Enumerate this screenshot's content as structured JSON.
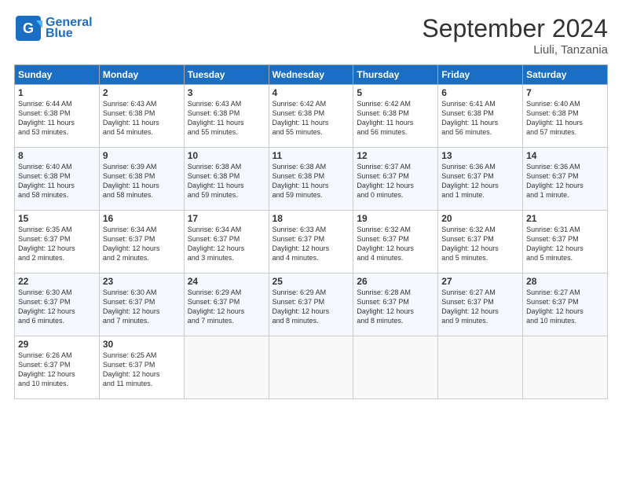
{
  "header": {
    "logo_line1": "General",
    "logo_line2": "Blue",
    "month_title": "September 2024",
    "location": "Liuli, Tanzania"
  },
  "days_of_week": [
    "Sunday",
    "Monday",
    "Tuesday",
    "Wednesday",
    "Thursday",
    "Friday",
    "Saturday"
  ],
  "weeks": [
    [
      {
        "day": "1",
        "text": "Sunrise: 6:44 AM\nSunset: 6:38 PM\nDaylight: 11 hours\nand 53 minutes."
      },
      {
        "day": "2",
        "text": "Sunrise: 6:43 AM\nSunset: 6:38 PM\nDaylight: 11 hours\nand 54 minutes."
      },
      {
        "day": "3",
        "text": "Sunrise: 6:43 AM\nSunset: 6:38 PM\nDaylight: 11 hours\nand 55 minutes."
      },
      {
        "day": "4",
        "text": "Sunrise: 6:42 AM\nSunset: 6:38 PM\nDaylight: 11 hours\nand 55 minutes."
      },
      {
        "day": "5",
        "text": "Sunrise: 6:42 AM\nSunset: 6:38 PM\nDaylight: 11 hours\nand 56 minutes."
      },
      {
        "day": "6",
        "text": "Sunrise: 6:41 AM\nSunset: 6:38 PM\nDaylight: 11 hours\nand 56 minutes."
      },
      {
        "day": "7",
        "text": "Sunrise: 6:40 AM\nSunset: 6:38 PM\nDaylight: 11 hours\nand 57 minutes."
      }
    ],
    [
      {
        "day": "8",
        "text": "Sunrise: 6:40 AM\nSunset: 6:38 PM\nDaylight: 11 hours\nand 58 minutes."
      },
      {
        "day": "9",
        "text": "Sunrise: 6:39 AM\nSunset: 6:38 PM\nDaylight: 11 hours\nand 58 minutes."
      },
      {
        "day": "10",
        "text": "Sunrise: 6:38 AM\nSunset: 6:38 PM\nDaylight: 11 hours\nand 59 minutes."
      },
      {
        "day": "11",
        "text": "Sunrise: 6:38 AM\nSunset: 6:38 PM\nDaylight: 11 hours\nand 59 minutes."
      },
      {
        "day": "12",
        "text": "Sunrise: 6:37 AM\nSunset: 6:37 PM\nDaylight: 12 hours\nand 0 minutes."
      },
      {
        "day": "13",
        "text": "Sunrise: 6:36 AM\nSunset: 6:37 PM\nDaylight: 12 hours\nand 1 minute."
      },
      {
        "day": "14",
        "text": "Sunrise: 6:36 AM\nSunset: 6:37 PM\nDaylight: 12 hours\nand 1 minute."
      }
    ],
    [
      {
        "day": "15",
        "text": "Sunrise: 6:35 AM\nSunset: 6:37 PM\nDaylight: 12 hours\nand 2 minutes."
      },
      {
        "day": "16",
        "text": "Sunrise: 6:34 AM\nSunset: 6:37 PM\nDaylight: 12 hours\nand 2 minutes."
      },
      {
        "day": "17",
        "text": "Sunrise: 6:34 AM\nSunset: 6:37 PM\nDaylight: 12 hours\nand 3 minutes."
      },
      {
        "day": "18",
        "text": "Sunrise: 6:33 AM\nSunset: 6:37 PM\nDaylight: 12 hours\nand 4 minutes."
      },
      {
        "day": "19",
        "text": "Sunrise: 6:32 AM\nSunset: 6:37 PM\nDaylight: 12 hours\nand 4 minutes."
      },
      {
        "day": "20",
        "text": "Sunrise: 6:32 AM\nSunset: 6:37 PM\nDaylight: 12 hours\nand 5 minutes."
      },
      {
        "day": "21",
        "text": "Sunrise: 6:31 AM\nSunset: 6:37 PM\nDaylight: 12 hours\nand 5 minutes."
      }
    ],
    [
      {
        "day": "22",
        "text": "Sunrise: 6:30 AM\nSunset: 6:37 PM\nDaylight: 12 hours\nand 6 minutes."
      },
      {
        "day": "23",
        "text": "Sunrise: 6:30 AM\nSunset: 6:37 PM\nDaylight: 12 hours\nand 7 minutes."
      },
      {
        "day": "24",
        "text": "Sunrise: 6:29 AM\nSunset: 6:37 PM\nDaylight: 12 hours\nand 7 minutes."
      },
      {
        "day": "25",
        "text": "Sunrise: 6:29 AM\nSunset: 6:37 PM\nDaylight: 12 hours\nand 8 minutes."
      },
      {
        "day": "26",
        "text": "Sunrise: 6:28 AM\nSunset: 6:37 PM\nDaylight: 12 hours\nand 8 minutes."
      },
      {
        "day": "27",
        "text": "Sunrise: 6:27 AM\nSunset: 6:37 PM\nDaylight: 12 hours\nand 9 minutes."
      },
      {
        "day": "28",
        "text": "Sunrise: 6:27 AM\nSunset: 6:37 PM\nDaylight: 12 hours\nand 10 minutes."
      }
    ],
    [
      {
        "day": "29",
        "text": "Sunrise: 6:26 AM\nSunset: 6:37 PM\nDaylight: 12 hours\nand 10 minutes."
      },
      {
        "day": "30",
        "text": "Sunrise: 6:25 AM\nSunset: 6:37 PM\nDaylight: 12 hours\nand 11 minutes."
      },
      {
        "day": "",
        "text": ""
      },
      {
        "day": "",
        "text": ""
      },
      {
        "day": "",
        "text": ""
      },
      {
        "day": "",
        "text": ""
      },
      {
        "day": "",
        "text": ""
      }
    ]
  ]
}
